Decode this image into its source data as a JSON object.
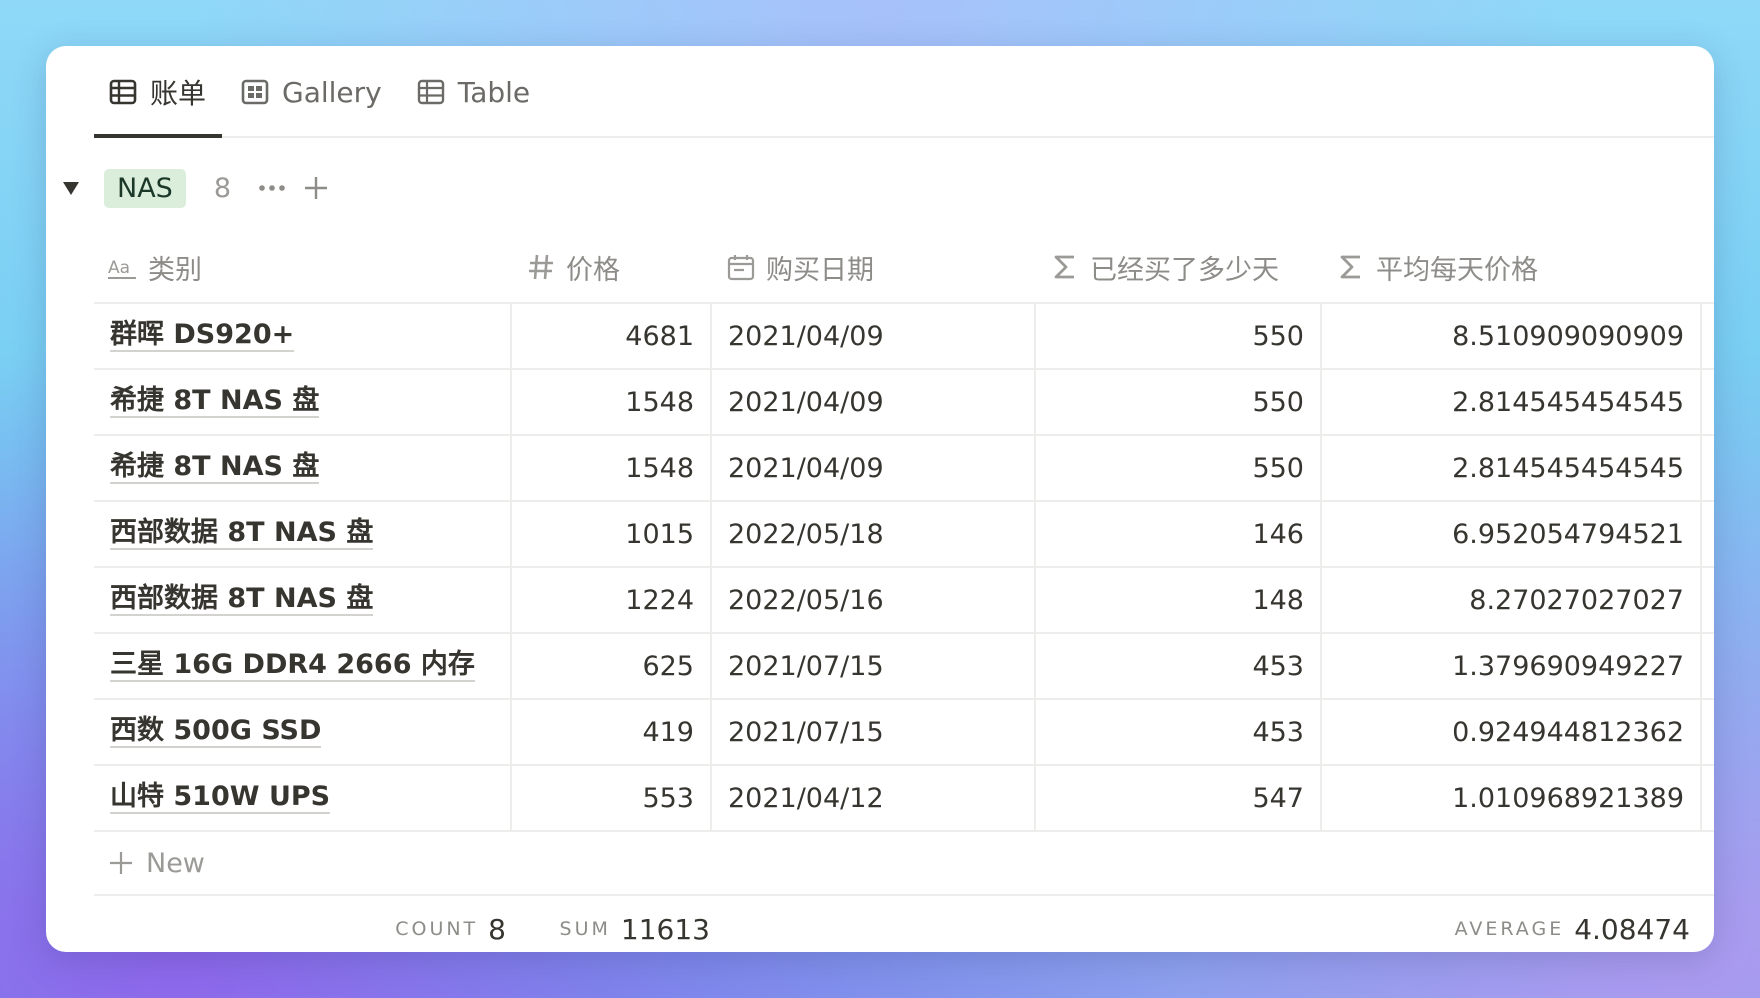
{
  "tabs": [
    {
      "label": "账单",
      "icon": "table-icon",
      "active": true
    },
    {
      "label": "Gallery",
      "icon": "gallery-icon",
      "active": false
    },
    {
      "label": "Table",
      "icon": "table-icon",
      "active": false
    }
  ],
  "group": {
    "tag": "NAS",
    "count": "8",
    "tag_color": "#dbeddb"
  },
  "columns": [
    {
      "label": "类别",
      "icon": "text-icon"
    },
    {
      "label": "价格",
      "icon": "hash-icon"
    },
    {
      "label": "购买日期",
      "icon": "calendar-icon"
    },
    {
      "label": "已经买了多少天",
      "icon": "sigma-icon"
    },
    {
      "label": "平均每天价格",
      "icon": "sigma-icon"
    }
  ],
  "rows": [
    {
      "name": "群晖 DS920+",
      "price": "4681",
      "date": "2021/04/09",
      "days": "550",
      "avg": "8.510909090909"
    },
    {
      "name": "希捷 8T NAS 盘",
      "price": "1548",
      "date": "2021/04/09",
      "days": "550",
      "avg": "2.814545454545"
    },
    {
      "name": "希捷 8T NAS 盘",
      "price": "1548",
      "date": "2021/04/09",
      "days": "550",
      "avg": "2.814545454545"
    },
    {
      "name": "西部数据 8T NAS 盘",
      "price": "1015",
      "date": "2022/05/18",
      "days": "146",
      "avg": "6.952054794521"
    },
    {
      "name": "西部数据 8T NAS 盘",
      "price": "1224",
      "date": "2022/05/16",
      "days": "148",
      "avg": "8.27027027027"
    },
    {
      "name": "三星 16G DDR4 2666 内存",
      "price": "625",
      "date": "2021/07/15",
      "days": "453",
      "avg": "1.379690949227"
    },
    {
      "name": "西数 500G SSD",
      "price": "419",
      "date": "2021/07/15",
      "days": "453",
      "avg": "0.924944812362"
    },
    {
      "name": "山特 510W UPS",
      "price": "553",
      "date": "2021/04/12",
      "days": "547",
      "avg": "1.010968921389"
    }
  ],
  "new_label": "New",
  "footer": {
    "count_label": "COUNT",
    "count_value": "8",
    "sum_label": "SUM",
    "sum_value": "11613",
    "avg_label": "AVERAGE",
    "avg_value": "4.08474"
  }
}
